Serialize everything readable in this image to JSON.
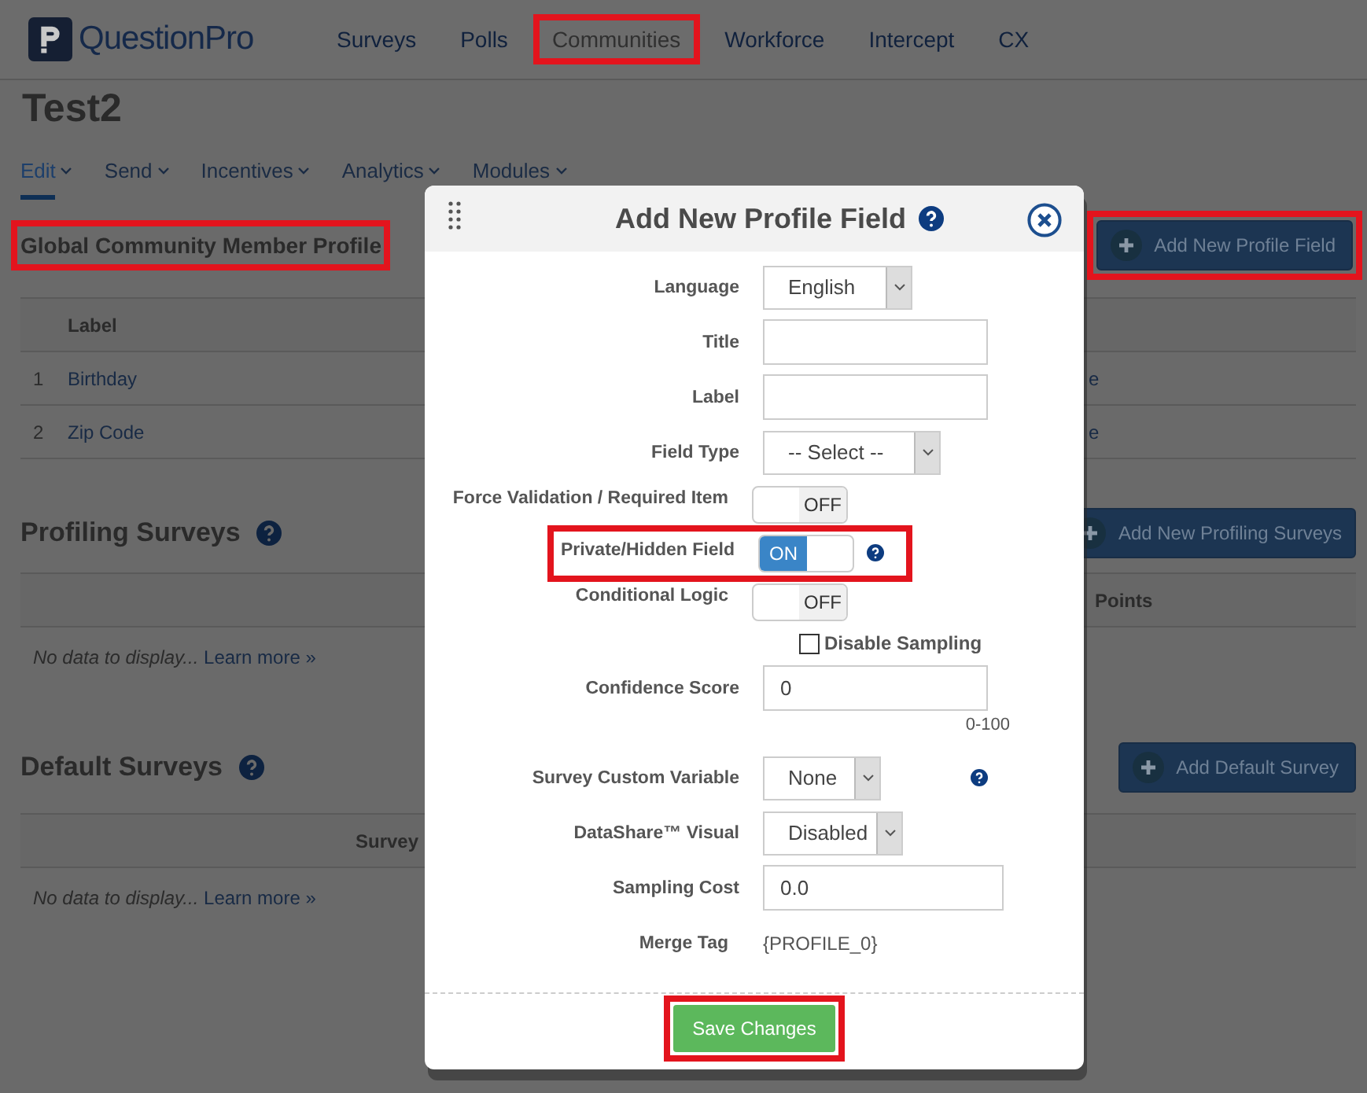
{
  "brand": "QuestionPro",
  "nav": [
    {
      "label": "Surveys",
      "highlighted": false
    },
    {
      "label": "Polls",
      "highlighted": false
    },
    {
      "label": "Communities",
      "highlighted": true
    },
    {
      "label": "Workforce",
      "highlighted": false
    },
    {
      "label": "Intercept",
      "highlighted": false
    },
    {
      "label": "CX",
      "highlighted": false
    }
  ],
  "page_title": "Test2",
  "subnav": [
    {
      "label": "Edit",
      "selected": true
    },
    {
      "label": "Send",
      "selected": false
    },
    {
      "label": "Incentives",
      "selected": false
    },
    {
      "label": "Analytics",
      "selected": false
    },
    {
      "label": "Modules",
      "selected": false
    }
  ],
  "profile_section": {
    "title": "Global Community Member Profile",
    "highlighted": true,
    "button": {
      "label": "Add New Profile Field",
      "highlighted": true
    },
    "columns": [
      "Label"
    ],
    "rows": [
      {
        "index": "1",
        "label": "Birthday",
        "column_3": "e"
      },
      {
        "index": "2",
        "label": "Zip Code",
        "column_3": "e"
      }
    ]
  },
  "profiling_section": {
    "title": "Profiling Surveys",
    "button": "Add New Profiling Surveys",
    "column": "Points",
    "empty_text": "No data to display...",
    "link": "Learn more »"
  },
  "default_section": {
    "title": "Default Surveys",
    "button": "Add Default Survey",
    "column": "Survey",
    "empty_text": "No data to display...",
    "link": "Learn more »"
  },
  "modal": {
    "title": "Add New Profile Field",
    "fields": [
      {
        "kind": "select",
        "label": "Language",
        "value": "English"
      },
      {
        "kind": "input",
        "label": "Title"
      },
      {
        "kind": "input",
        "label": "Label"
      },
      {
        "kind": "select",
        "label": "Field Type",
        "value": "-- Select --"
      },
      {
        "kind": "toggle",
        "label": "Force Validation / Required Item",
        "on": false,
        "state_text": "OFF",
        "highlighted": false,
        "help": false
      },
      {
        "kind": "toggle",
        "label": "Private/Hidden Field",
        "on": true,
        "state_text": "ON",
        "highlighted": true,
        "help": true
      },
      {
        "kind": "toggle",
        "label": "Conditional Logic",
        "on": false,
        "state_text": "OFF",
        "highlighted": false,
        "help": false
      },
      {
        "kind": "checkbox",
        "label": "Disable Sampling",
        "checked": false
      },
      {
        "kind": "input",
        "label": "Confidence Score",
        "value": "0",
        "hint": "0-100"
      },
      {
        "kind": "select",
        "label": "Survey Custom Variable",
        "value": "None",
        "help": true
      },
      {
        "kind": "select",
        "label": "DataShare™ Visual",
        "value": "Disabled"
      },
      {
        "kind": "input",
        "label": "Sampling Cost",
        "value": "0.0"
      },
      {
        "kind": "text",
        "label": "Merge Tag",
        "value": "{PROFILE_0}"
      }
    ],
    "save_button": {
      "label": "Save Changes",
      "highlighted": true
    }
  }
}
